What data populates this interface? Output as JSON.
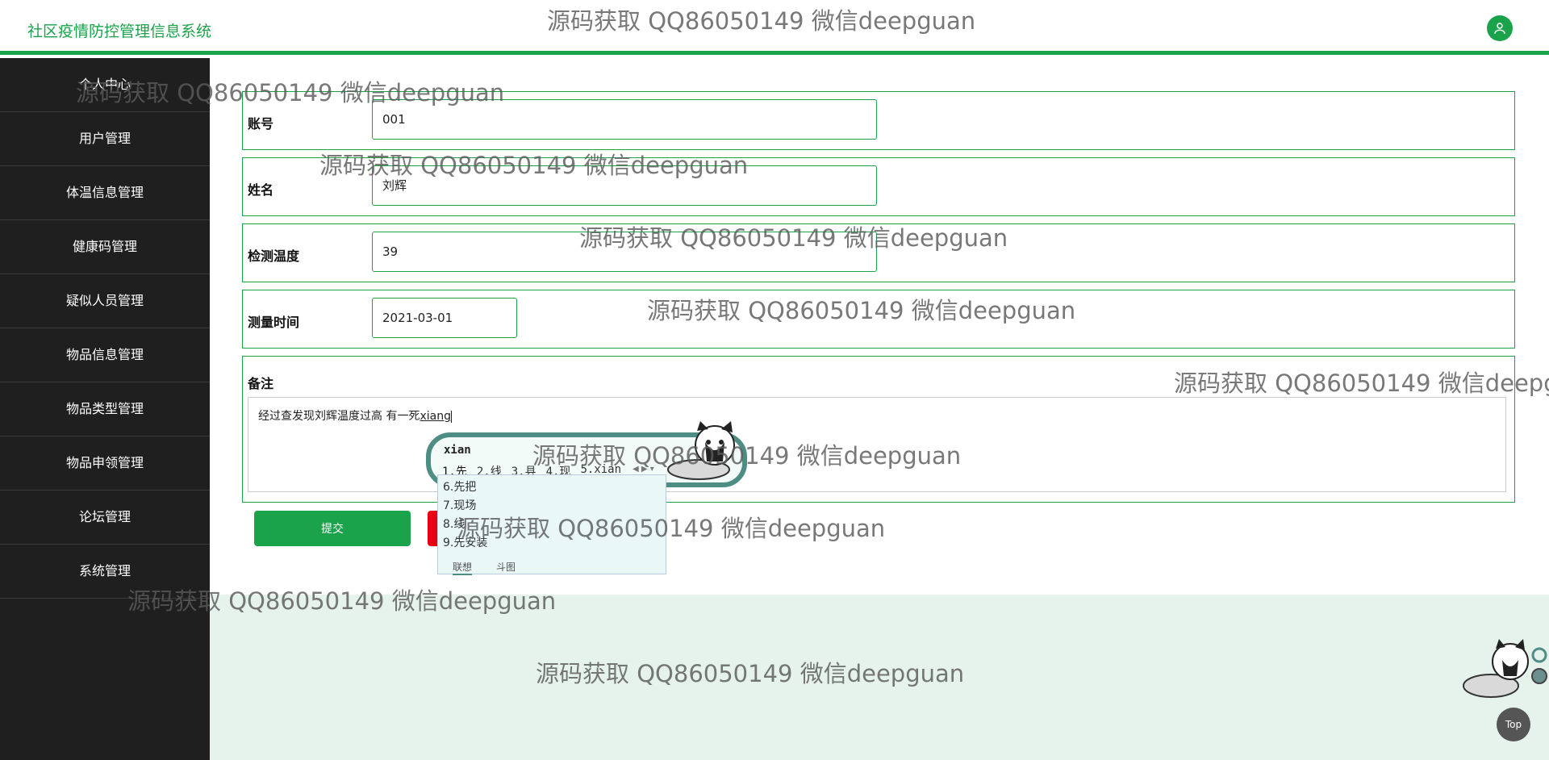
{
  "header": {
    "title": "社区疫情防控管理信息系统",
    "user_icon": "user-icon"
  },
  "sidebar": {
    "items": [
      {
        "label": "个人中心"
      },
      {
        "label": "用户管理"
      },
      {
        "label": "体温信息管理"
      },
      {
        "label": "健康码管理"
      },
      {
        "label": "疑似人员管理"
      },
      {
        "label": "物品信息管理"
      },
      {
        "label": "物品类型管理"
      },
      {
        "label": "物品申领管理"
      },
      {
        "label": "论坛管理"
      },
      {
        "label": "系统管理"
      }
    ]
  },
  "form": {
    "account": {
      "label": "账号",
      "value": "001"
    },
    "name": {
      "label": "姓名",
      "value": "刘辉"
    },
    "temperature": {
      "label": "检测温度",
      "value": "39"
    },
    "time": {
      "label": "测量时间",
      "value": "2021-03-01"
    },
    "note": {
      "label": "备注",
      "text": "经过查发现刘辉温度过高 有一死",
      "composing": "xiang"
    },
    "submit_label": "提交",
    "cancel_label": ""
  },
  "ime": {
    "input": "xian",
    "candidates_row": [
      "1.先",
      "2.线",
      "3.县",
      "4.现",
      "5.xian"
    ],
    "candidates_list": [
      "6.先把",
      "7.现场",
      "8.线",
      "9.先安装"
    ],
    "tabs": [
      "联想",
      "斗图"
    ]
  },
  "top_button": "Top",
  "watermark": "源码获取 QQ86050149 微信deepguan",
  "colors": {
    "accent": "#1aa34a",
    "danger": "#e60012",
    "sidebar_bg": "#1f1f1f",
    "footer_bg": "#e6f3ec"
  }
}
